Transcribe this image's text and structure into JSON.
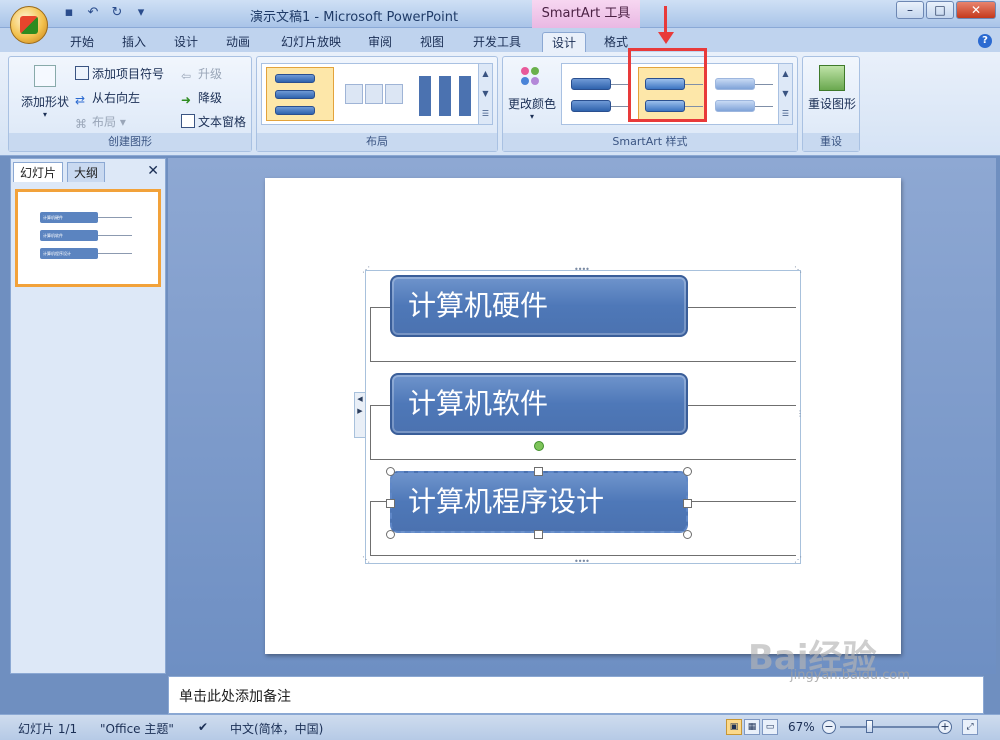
{
  "window": {
    "title": "演示文稿1 - Microsoft PowerPoint",
    "contextual_tools": "SmartArt 工具"
  },
  "ribbon_tabs": [
    "开始",
    "插入",
    "设计",
    "动画",
    "幻灯片放映",
    "审阅",
    "视图",
    "开发工具",
    "设计",
    "格式"
  ],
  "active_tab": "设计",
  "groups": {
    "create_graphic": {
      "label": "创建图形",
      "add_shape": "添加形状",
      "add_bullet": "添加项目符号",
      "right_to_left": "从右向左",
      "layout_btn": "布局",
      "promote": "升级",
      "demote": "降级",
      "text_pane": "文本窗格"
    },
    "layouts": {
      "label": "布局"
    },
    "styles": {
      "label": "SmartArt 样式",
      "change_colors": "更改颜色"
    },
    "reset": {
      "label": "重设",
      "reset_graphic": "重设图形"
    }
  },
  "left_pane": {
    "tab_slides": "幻灯片",
    "tab_outline": "大纲",
    "thumbnail_number": "1",
    "thumb_items": [
      "计算机硬件",
      "计算机软件",
      "计算机程序设计"
    ]
  },
  "slide": {
    "items": [
      "计算机硬件",
      "计算机软件",
      "计算机程序设计"
    ]
  },
  "notes": {
    "placeholder": "单击此处添加备注"
  },
  "status": {
    "slide_counter": "幻灯片 1/1",
    "theme": "\"Office 主题\"",
    "language": "中文(简体，中国)",
    "zoom": "67%"
  },
  "watermark": {
    "text": "Bai经验",
    "sub": "jingyan.baidu.com"
  }
}
